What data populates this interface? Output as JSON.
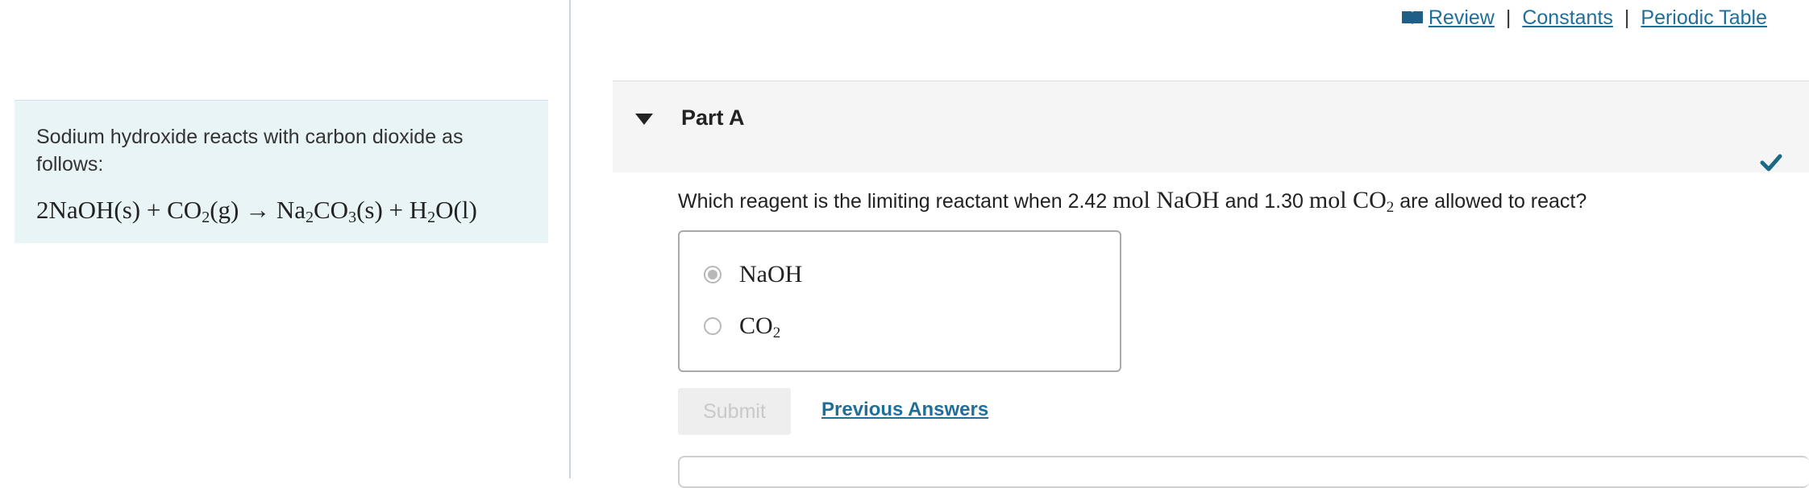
{
  "intro": {
    "text": "Sodium hydroxide reacts with carbon dioxide as follows:",
    "equation": {
      "t1": "2NaOH(s) + CO",
      "s1": "2",
      "t2": "(g) → Na",
      "s2": "2",
      "t3": "CO",
      "s3": "3",
      "t4": "(s) + H",
      "s4": "2",
      "t5": "O(l)"
    }
  },
  "top_links": {
    "review": "Review",
    "separator": "|",
    "constants": "Constants",
    "periodic_table": "Periodic Table"
  },
  "part": {
    "title": "Part A",
    "status": "correct"
  },
  "question": {
    "t1": "Which reagent is the limiting reactant when 2.42 ",
    "m1": "mol NaOH",
    "t2": " and 1.30 ",
    "m2": "mol CO",
    "m2sub": "2",
    "t3": " are allowed to react?"
  },
  "options": [
    {
      "label": "NaOH",
      "sub": "",
      "selected": true
    },
    {
      "label": "CO",
      "sub": "2",
      "selected": false
    }
  ],
  "actions": {
    "submit": "Submit",
    "previous_answers": "Previous Answers"
  },
  "colors": {
    "link": "#1f6f9a",
    "intro_bg": "#e8f4f6",
    "check": "#1a6a86"
  },
  "icons": {
    "review": "book-icon",
    "caret": "caret-down-icon",
    "status": "checkmark-icon"
  }
}
